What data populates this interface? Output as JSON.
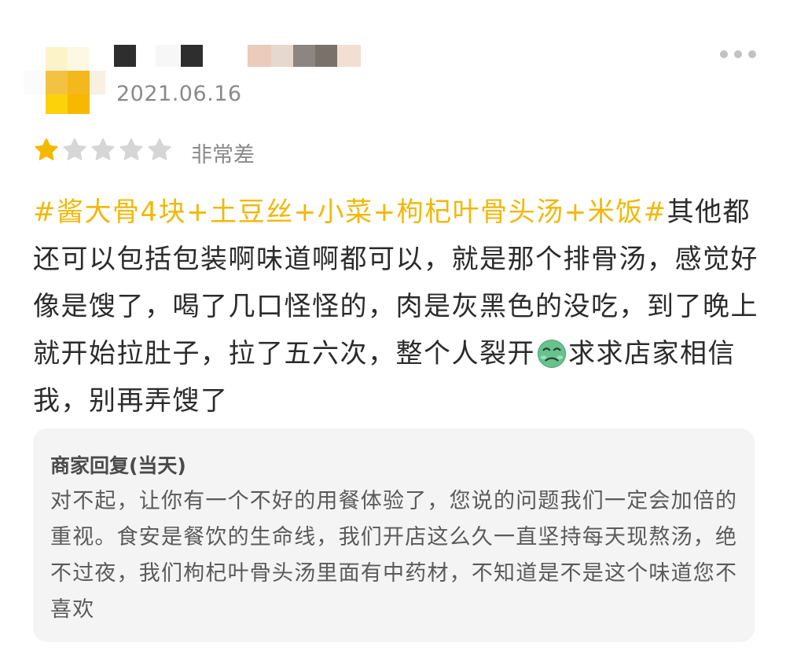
{
  "review": {
    "date": "2021.06.16",
    "rating": {
      "stars": 1,
      "max": 5,
      "label": "非常差"
    },
    "tag_text": "#酱大骨4块+土豆丝+小菜+枸杞叶骨头汤+米饭#",
    "body_part1": "其他都还可以包括包装啊味道啊都可以，就是那个排骨汤，感觉好像是馊了，喝了几口怪怪的，肉是灰黑色的没吃，到了晚上就开始拉肚子，拉了五六次，整个人裂开",
    "emoji_icon": "nauseated-face-icon",
    "body_part2": "求求店家相信我，别再弄馊了"
  },
  "merchant_reply": {
    "title": "商家回复(当天)",
    "body": "对不起，让你有一个不好的用餐体验了，您说的问题我们一定会加倍的重视。食安是餐饮的生命线，我们开店这么久一直坚持每天现熬汤，绝不过夜，我们枸杞叶骨头汤里面有中药材，不知道是不是这个味道您不喜欢"
  },
  "colors": {
    "tag": "#f2b705",
    "star_filled": "#f5b800",
    "star_empty": "#d6d6d6"
  }
}
